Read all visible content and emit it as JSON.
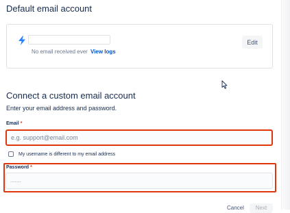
{
  "default_account": {
    "title": "Default email account",
    "email_value": "",
    "status_text": "No email received ever",
    "view_logs_label": "View logs",
    "edit_label": "Edit"
  },
  "custom_account": {
    "title": "Connect a custom email account",
    "subtitle": "Enter your email address and password.",
    "email": {
      "label": "Email",
      "required_marker": "*",
      "placeholder": "e.g. support@email.com",
      "value": ""
    },
    "username_checkbox": {
      "label": "My username is different to my email address",
      "checked": false
    },
    "password": {
      "label": "Password",
      "required_marker": "*",
      "placeholder": "........",
      "value": ""
    }
  },
  "footer": {
    "cancel_label": "Cancel",
    "next_label": "Next"
  },
  "icons": {
    "bolt": "lightning-bolt-icon",
    "cursor": "mouse-pointer-icon"
  },
  "colors": {
    "accent": "#0052cc",
    "bolt": "#2684ff",
    "error": "#de350b",
    "text": "#172b4d"
  }
}
